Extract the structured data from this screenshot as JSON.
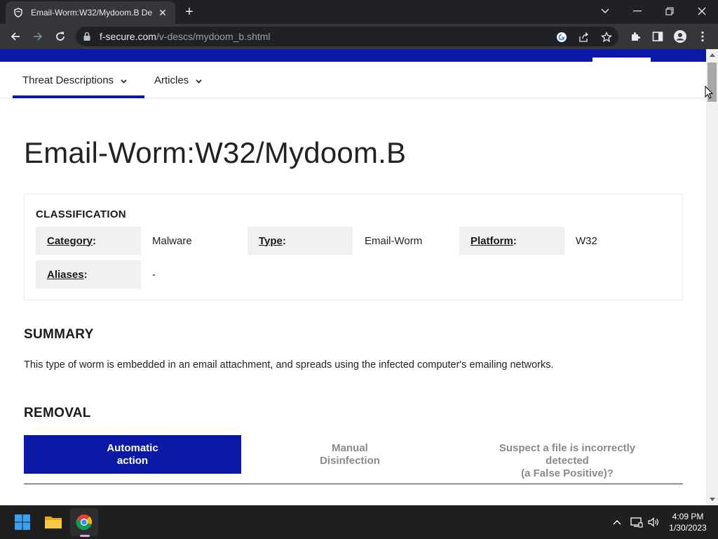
{
  "browser": {
    "tab_title": "Email-Worm:W32/Mydoom.B De",
    "url_host": "f-secure.com",
    "url_path": "/v-descs/mydoom_b.shtml"
  },
  "subnav": {
    "items": [
      {
        "label": "Threat Descriptions"
      },
      {
        "label": "Articles"
      }
    ]
  },
  "page": {
    "title": "Email-Worm:W32/Mydoom.B"
  },
  "classification": {
    "heading": "CLASSIFICATION",
    "category_key": "Category",
    "category_value": "Malware",
    "type_key": "Type",
    "type_value": "Email-Worm",
    "platform_key": "Platform",
    "platform_value": "W32",
    "aliases_key": "Aliases",
    "aliases_value": "-"
  },
  "summary": {
    "heading": "SUMMARY",
    "text": "This type of worm is embedded in an email attachment, and spreads using the infected computer's emailing networks."
  },
  "removal": {
    "heading": "REMOVAL",
    "tabs": [
      {
        "line1": "Automatic",
        "line2": "action",
        "line3": ""
      },
      {
        "line1": "Manual",
        "line2": "Disinfection",
        "line3": ""
      },
      {
        "line1": "Suspect a file is incorrectly",
        "line2": "detected",
        "line3": "(a False Positive)?"
      }
    ]
  },
  "taskbar": {
    "time": "4:09 PM",
    "date": "1/30/2023"
  },
  "colors": {
    "brand_blue": "#0b1aa6",
    "chrome_dark": "#202124",
    "chrome_toolbar": "#35363a"
  }
}
